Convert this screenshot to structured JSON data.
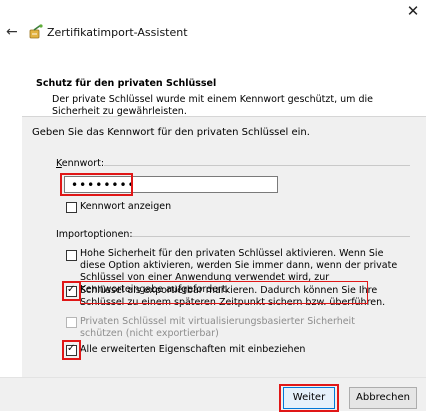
{
  "window": {
    "title": "Zertifikatimport-Assistent"
  },
  "header": {
    "title": "Schutz für den privaten Schlüssel",
    "description": "Der private Schlüssel wurde mit einem Kennwort geschützt, um die Sicherheit zu gewährleisten."
  },
  "content": {
    "instruction": "Geben Sie das Kennwort für den privaten Schlüssel ein.",
    "password": {
      "label": "Kennwort:",
      "value": "••••••••",
      "show_label": "Kennwort anzeigen",
      "show_checked": false
    },
    "options": {
      "label": "Importoptionen:",
      "items": [
        {
          "text": "Hohe Sicherheit für den privaten Schlüssel aktivieren. Wenn Sie diese Option aktivieren, werden Sie immer dann, wenn der private Schlüssel von einer Anwendung verwendet wird, zur Kennworteingabe aufgefordert.",
          "checked": false,
          "enabled": true
        },
        {
          "text": "Schlüssel als exportierbar markieren. Dadurch können Sie Ihre Schlüssel zu einem späteren Zeitpunkt sichern bzw. überführen.",
          "checked": true,
          "enabled": true
        },
        {
          "text": "Privaten Schlüssel mit virtualisierungsbasierter Sicherheit schützen (nicht exportierbar)",
          "checked": false,
          "enabled": false
        },
        {
          "text": "Alle erweiterten Eigenschaften mit einbeziehen",
          "checked": true,
          "enabled": true
        }
      ]
    }
  },
  "footer": {
    "next_label": "Weiter",
    "cancel_label": "Abbrechen"
  },
  "icons": {
    "close": "close-icon",
    "back": "back-arrow-icon",
    "wizard": "certificate-wizard-icon"
  },
  "colors": {
    "highlight": "#e01717",
    "accent": "#0078d7"
  }
}
